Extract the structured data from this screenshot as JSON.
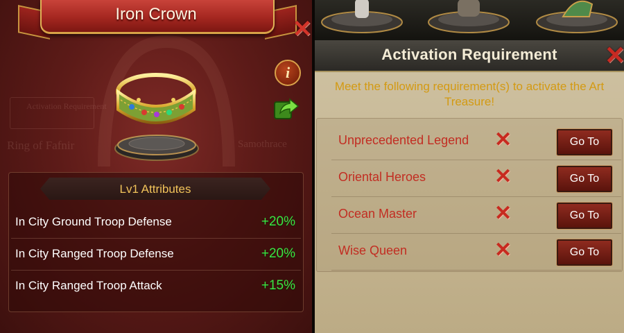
{
  "left_panel": {
    "title": "Iron Crown",
    "background_texts": [
      "Activation Requirement",
      "Ring of Fafnir",
      "Samothrace"
    ],
    "attributes_header": "Lv1 Attributes",
    "attributes": [
      {
        "name": "In City Ground Troop Defense",
        "value": "+20%"
      },
      {
        "name": "In City Ranged Troop Defense",
        "value": "+20%"
      },
      {
        "name": "In City Ranged Troop Attack",
        "value": "+15%"
      }
    ],
    "info_icon_glyph": "i"
  },
  "right_panel": {
    "title": "Activation Requirement",
    "subtitle_line1": "Meet the following requirement(s) to activate the Art",
    "subtitle_line2": "Treasure!",
    "requirements": [
      {
        "name": "Unprecedented Legend",
        "status": "not-met",
        "button": "Go To"
      },
      {
        "name": "Oriental Heroes",
        "status": "not-met",
        "button": "Go To"
      },
      {
        "name": "Ocean Master",
        "status": "not-met",
        "button": "Go To"
      },
      {
        "name": "Wise Queen",
        "status": "not-met",
        "button": "Go To"
      }
    ]
  },
  "colors": {
    "bonus_green": "#3fe043",
    "requirement_red": "#c22d22",
    "subtitle_gold": "#d39a12",
    "header_gold": "#f1c35a"
  },
  "icons": {
    "close": "close-icon",
    "info": "info-icon",
    "share": "share-icon",
    "not_met": "cross-icon"
  }
}
